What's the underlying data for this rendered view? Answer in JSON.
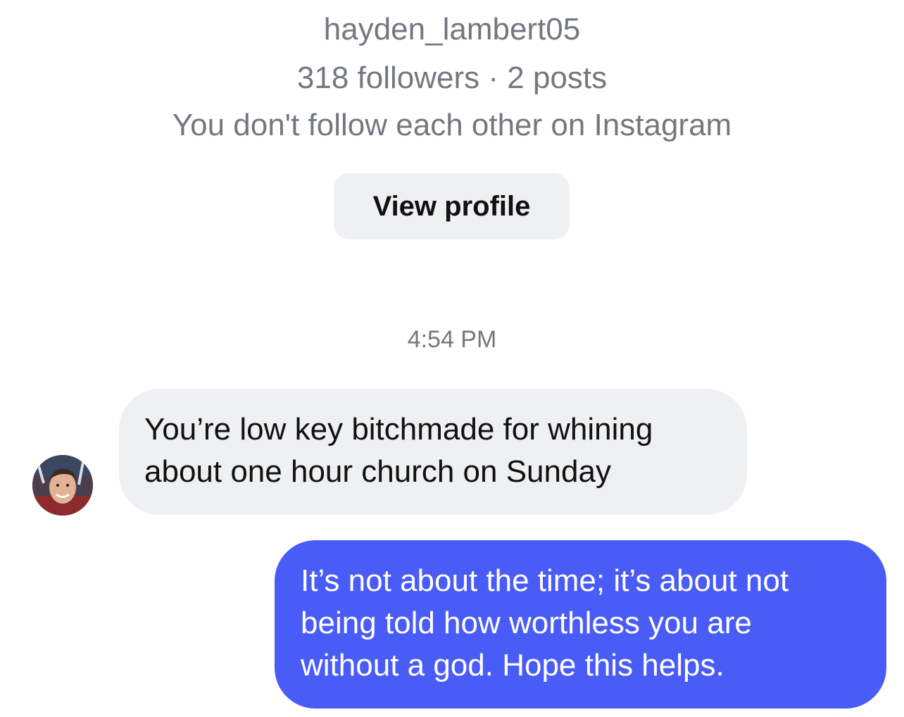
{
  "profile": {
    "username": "hayden_lambert05",
    "stats": "318 followers · 2 posts",
    "relation": "You don't follow each other on Instagram",
    "view_profile_label": "View profile"
  },
  "thread": {
    "timestamp": "4:54 PM",
    "messages": [
      {
        "direction": "incoming",
        "lines": [
          "You’re low key bitchmade for whining",
          "about one hour church on Sunday"
        ]
      },
      {
        "direction": "outgoing",
        "lines": [
          "It’s not about the time; it’s about not",
          "being told how worthless you are",
          "without a god. Hope this helps."
        ]
      }
    ]
  },
  "colors": {
    "outgoing_bubble": "#4a5cf7",
    "incoming_bubble": "#eff0f2",
    "secondary_text": "#737880"
  }
}
